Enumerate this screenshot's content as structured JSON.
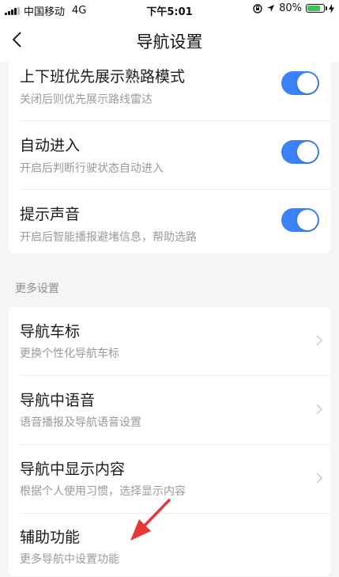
{
  "status_bar": {
    "carrier": "中国移动",
    "network": "4G",
    "time": "下午5:01",
    "battery": "80%",
    "battery_level": 0.8
  },
  "nav": {
    "title": "导航设置",
    "back_icon": "chevron-left-icon"
  },
  "toggles": [
    {
      "title": "上下班优先展示熟路模式",
      "subtitle": "关闭后则优先展示路线雷达",
      "on": true
    },
    {
      "title": "自动进入",
      "subtitle": "开启后判断行驶状态自动进入",
      "on": true
    },
    {
      "title": "提示声音",
      "subtitle": "开启后智能播报避堵信息，帮助选路",
      "on": true
    }
  ],
  "more_settings": {
    "label": "更多设置",
    "items": [
      {
        "title": "导航车标",
        "subtitle": "更换个性化导航车标"
      },
      {
        "title": "导航中语音",
        "subtitle": "语音播报及导航语音设置"
      },
      {
        "title": "导航中显示内容",
        "subtitle": "根据个人使用习惯，选择显示内容"
      },
      {
        "title": "辅助功能",
        "subtitle": "更多导航中设置功能"
      }
    ]
  },
  "colors": {
    "toggle_on": "#3b82f6",
    "annotation_arrow": "#e53935",
    "background": "#f4f5f7"
  }
}
